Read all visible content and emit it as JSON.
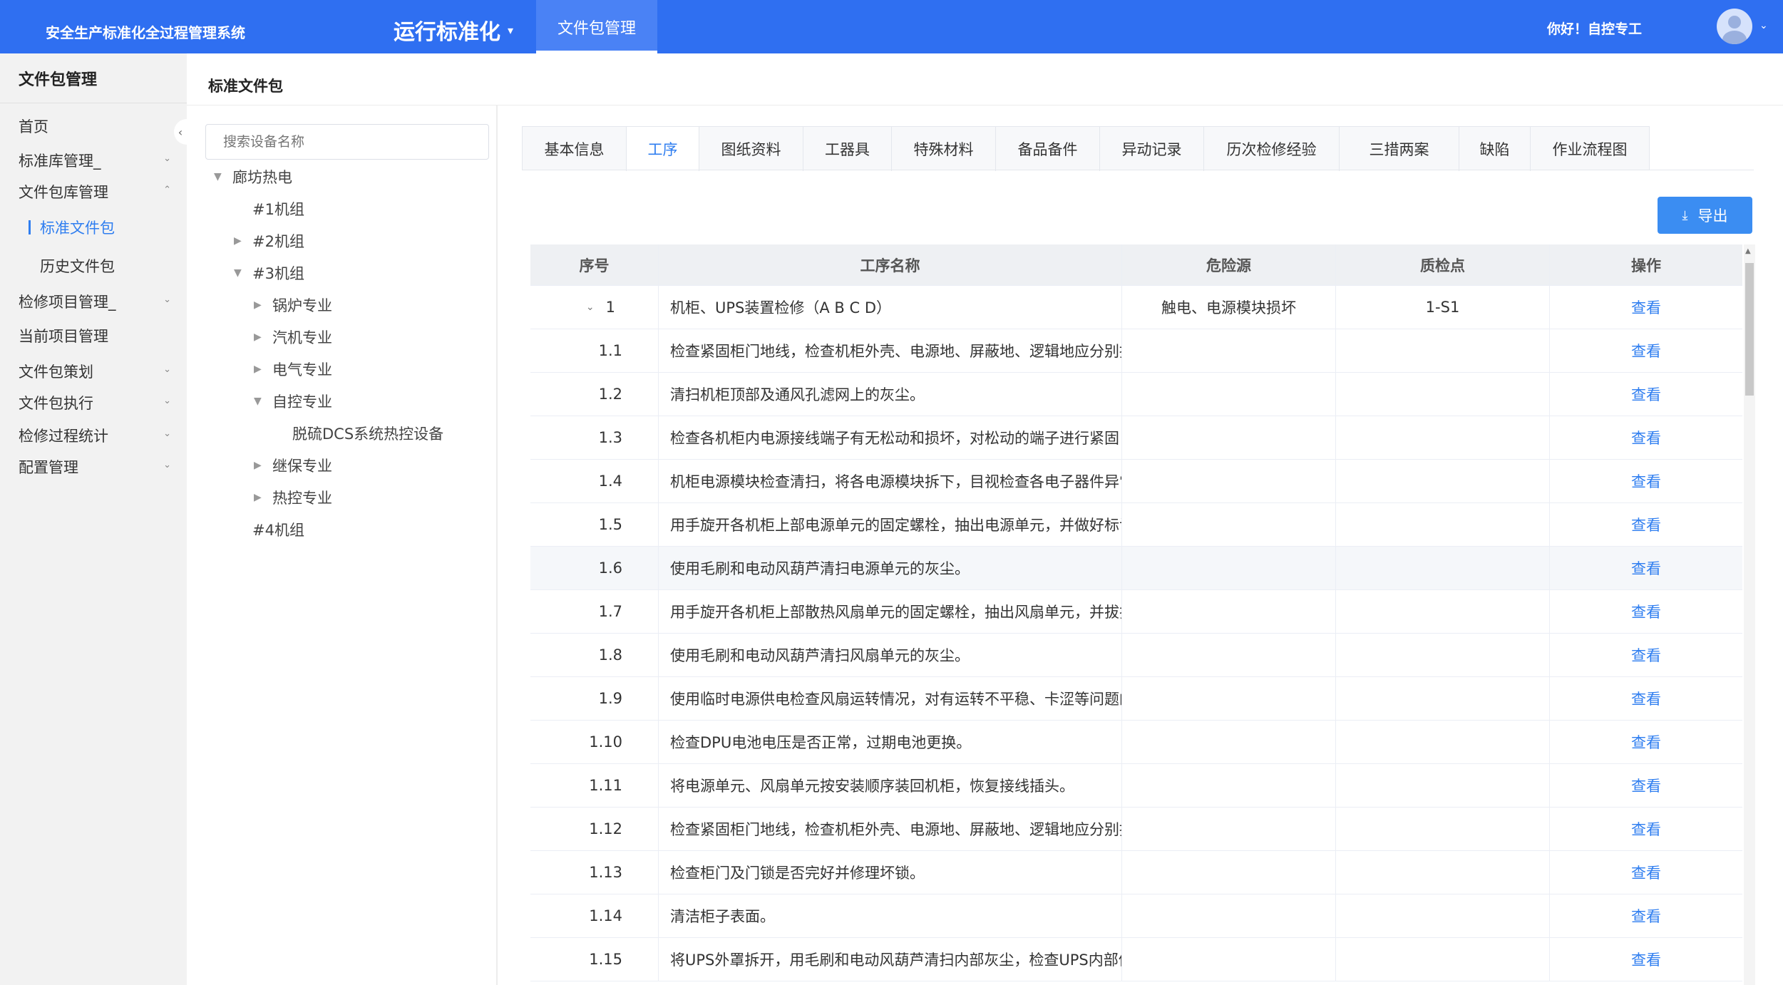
{
  "header": {
    "system_title": "安全生产标准化全过程管理系统",
    "module": "运行标准化",
    "module_caret": "▾",
    "nav_tab": "文件包管理",
    "greeting": "你好！自控专工",
    "avatar_caret": "⌄"
  },
  "sidebar": {
    "title": "文件包管理",
    "collapse_icon": "‹",
    "items": [
      {
        "label": "首页",
        "arrow": ""
      },
      {
        "label": "标准库管理_",
        "arrow": "⌄"
      },
      {
        "label": "文件包库管理",
        "arrow": "⌃"
      },
      {
        "label": "标准文件包",
        "arrow": ""
      },
      {
        "label": "历史文件包",
        "arrow": ""
      },
      {
        "label": "检修项目管理_",
        "arrow": "⌄"
      },
      {
        "label": "当前项目管理",
        "arrow": ""
      },
      {
        "label": "文件包策划",
        "arrow": "⌄"
      },
      {
        "label": "文件包执行",
        "arrow": "⌄"
      },
      {
        "label": "检修过程统计",
        "arrow": "⌄"
      },
      {
        "label": "配置管理",
        "arrow": "⌄"
      }
    ]
  },
  "content": {
    "title": "标准文件包"
  },
  "tree": {
    "search_placeholder": "搜索设备名称",
    "nodes": [
      {
        "label": "廊坊热电",
        "toggle": "▼"
      },
      {
        "label": "#1机组",
        "toggle": ""
      },
      {
        "label": "#2机组",
        "toggle": "▶"
      },
      {
        "label": "#3机组",
        "toggle": "▼"
      },
      {
        "label": "锅炉专业",
        "toggle": "▶"
      },
      {
        "label": "汽机专业",
        "toggle": "▶"
      },
      {
        "label": "电气专业",
        "toggle": "▶"
      },
      {
        "label": "自控专业",
        "toggle": "▼"
      },
      {
        "label": "脱硫DCS系统热控设备",
        "toggle": ""
      },
      {
        "label": "继保专业",
        "toggle": "▶"
      },
      {
        "label": "热控专业",
        "toggle": "▶"
      },
      {
        "label": "#4机组",
        "toggle": ""
      }
    ]
  },
  "tabs": [
    "基本信息",
    "工序",
    "图纸资料",
    "工器具",
    "特殊材料",
    "备品备件",
    "异动记录",
    "历次检修经验",
    "三措两案",
    "缺陷",
    "作业流程图"
  ],
  "active_tab": "工序",
  "export": {
    "label": "导出",
    "icon": "⤓"
  },
  "table": {
    "headers": [
      "序号",
      "工序名称",
      "危险源",
      "质检点",
      "操作"
    ],
    "expander": "⌄",
    "rows": [
      {
        "no": "1",
        "name": "机柜、UPS装置检修（A B C D）",
        "hazard": "触电、电源模块损坏",
        "qc": "1-S1",
        "action": "查看"
      },
      {
        "no": "1.1",
        "name": "检查紧固柜门地线，检查机柜外壳、电源地、屏蔽地、逻辑地应分别接",
        "hazard": "",
        "qc": "",
        "action": "查看"
      },
      {
        "no": "1.2",
        "name": "清扫机柜顶部及通风孔滤网上的灰尘。",
        "hazard": "",
        "qc": "",
        "action": "查看"
      },
      {
        "no": "1.3",
        "name": "检查各机柜内电源接线端子有无松动和损坏，对松动的端子进行紧固",
        "hazard": "",
        "qc": "",
        "action": "查看"
      },
      {
        "no": "1.4",
        "name": "机柜电源模块检查清扫，将各电源模块拆下，目视检查各电子器件异常",
        "hazard": "",
        "qc": "",
        "action": "查看"
      },
      {
        "no": "1.5",
        "name": "用手旋开各机柜上部电源单元的固定螺栓，抽出电源单元，并做好标记",
        "hazard": "",
        "qc": "",
        "action": "查看"
      },
      {
        "no": "1.6",
        "name": "使用毛刷和电动风葫芦清扫电源单元的灰尘。",
        "hazard": "",
        "qc": "",
        "action": "查看"
      },
      {
        "no": "1.7",
        "name": "用手旋开各机柜上部散热风扇单元的固定螺栓，抽出风扇单元，并拔插",
        "hazard": "",
        "qc": "",
        "action": "查看"
      },
      {
        "no": "1.8",
        "name": "使用毛刷和电动风葫芦清扫风扇单元的灰尘。",
        "hazard": "",
        "qc": "",
        "action": "查看"
      },
      {
        "no": "1.9",
        "name": "使用临时电源供电检查风扇运转情况，对有运转不平稳、卡涩等问题的",
        "hazard": "",
        "qc": "",
        "action": "查看"
      },
      {
        "no": "1.10",
        "name": "检查DPU电池电压是否正常，过期电池更换。",
        "hazard": "",
        "qc": "",
        "action": "查看"
      },
      {
        "no": "1.11",
        "name": "将电源单元、风扇单元按安装顺序装回机柜，恢复接线插头。",
        "hazard": "",
        "qc": "",
        "action": "查看"
      },
      {
        "no": "1.12",
        "name": "检查紧固柜门地线，检查机柜外壳、电源地、屏蔽地、逻辑地应分别接",
        "hazard": "",
        "qc": "",
        "action": "查看"
      },
      {
        "no": "1.13",
        "name": "检查柜门及门锁是否完好并修理坏锁。",
        "hazard": "",
        "qc": "",
        "action": "查看"
      },
      {
        "no": "1.14",
        "name": "清洁柜子表面。",
        "hazard": "",
        "qc": "",
        "action": "查看"
      },
      {
        "no": "1.15",
        "name": "将UPS外罩拆开，用毛刷和电动风葫芦清扫内部灰尘，检查UPS内部件",
        "hazard": "",
        "qc": "",
        "action": "查看"
      }
    ]
  },
  "scrollbar": {
    "up_icon": "▲"
  }
}
